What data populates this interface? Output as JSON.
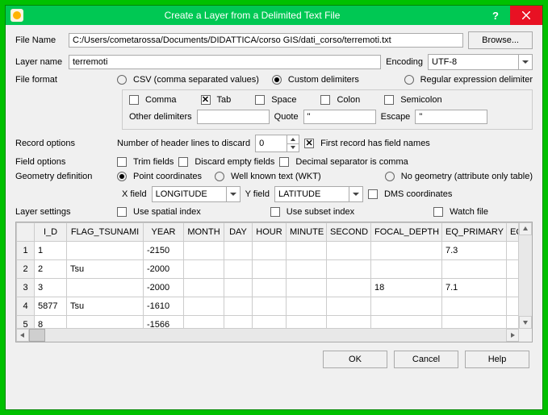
{
  "title": "Create a Layer from a Delimited Text File",
  "labels": {
    "file_name": "File Name",
    "browse": "Browse...",
    "layer_name": "Layer name",
    "encoding": "Encoding",
    "file_format": "File format",
    "csv": "CSV (comma separated values)",
    "custom": "Custom delimiters",
    "regex": "Regular expression delimiter",
    "comma": "Comma",
    "tab": "Tab",
    "space": "Space",
    "colon": "Colon",
    "semicolon": "Semicolon",
    "other_delimiters": "Other delimiters",
    "quote": "Quote",
    "escape": "Escape",
    "record_options": "Record options",
    "header_lines": "Number of header lines to discard",
    "first_record": "First record has field names",
    "field_options": "Field options",
    "trim": "Trim fields",
    "discard_empty": "Discard empty fields",
    "decimal_sep": "Decimal separator is comma",
    "geometry_def": "Geometry definition",
    "point_coords": "Point coordinates",
    "wkt": "Well known text (WKT)",
    "no_geom": "No geometry (attribute only table)",
    "x_field": "X field",
    "y_field": "Y field",
    "dms": "DMS coordinates",
    "layer_settings": "Layer settings",
    "spatial_index": "Use spatial index",
    "subset_index": "Use subset index",
    "watch_file": "Watch file"
  },
  "values": {
    "file_name": "C:/Users/cometarossa/Documents/DIDATTICA/corso GIS/dati_corso/terremoti.txt",
    "layer_name": "terremoti",
    "encoding": "UTF-8",
    "header_lines": "0",
    "quote": "\"",
    "escape": "\"",
    "x_field": "LONGITUDE",
    "y_field": "LATITUDE"
  },
  "buttons": {
    "ok": "OK",
    "cancel": "Cancel",
    "help": "Help"
  },
  "table": {
    "headers": [
      "I_D",
      "FLAG_TSUNAMI",
      "YEAR",
      "MONTH",
      "DAY",
      "HOUR",
      "MINUTE",
      "SECOND",
      "FOCAL_DEPTH",
      "EQ_PRIMARY",
      "EQ_MAG"
    ],
    "rows": [
      {
        "n": "1",
        "I_D": "1",
        "FLAG_TSUNAMI": "",
        "YEAR": "-2150",
        "MONTH": "",
        "DAY": "",
        "HOUR": "",
        "MINUTE": "",
        "SECOND": "",
        "FOCAL_DEPTH": "",
        "EQ_PRIMARY": "7.3",
        "EQ_MAG": ""
      },
      {
        "n": "2",
        "I_D": "2",
        "FLAG_TSUNAMI": "Tsu",
        "YEAR": "-2000",
        "MONTH": "",
        "DAY": "",
        "HOUR": "",
        "MINUTE": "",
        "SECOND": "",
        "FOCAL_DEPTH": "",
        "EQ_PRIMARY": "",
        "EQ_MAG": ""
      },
      {
        "n": "3",
        "I_D": "3",
        "FLAG_TSUNAMI": "",
        "YEAR": "-2000",
        "MONTH": "",
        "DAY": "",
        "HOUR": "",
        "MINUTE": "",
        "SECOND": "",
        "FOCAL_DEPTH": "18",
        "EQ_PRIMARY": "7.1",
        "EQ_MAG": ""
      },
      {
        "n": "4",
        "I_D": "5877",
        "FLAG_TSUNAMI": "Tsu",
        "YEAR": "-1610",
        "MONTH": "",
        "DAY": "",
        "HOUR": "",
        "MINUTE": "",
        "SECOND": "",
        "FOCAL_DEPTH": "",
        "EQ_PRIMARY": "",
        "EQ_MAG": ""
      },
      {
        "n": "5",
        "I_D": "8",
        "FLAG_TSUNAMI": "",
        "YEAR": "-1566",
        "MONTH": "",
        "DAY": "",
        "HOUR": "",
        "MINUTE": "",
        "SECOND": "",
        "FOCAL_DEPTH": "",
        "EQ_PRIMARY": "",
        "EQ_MAG": ""
      }
    ]
  }
}
